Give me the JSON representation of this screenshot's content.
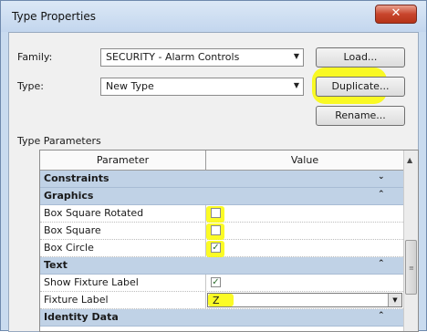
{
  "dialog": {
    "title": "Type Properties",
    "close_symbol": "✕"
  },
  "family": {
    "label": "Family:",
    "value": "SECURITY - Alarm Controls"
  },
  "type": {
    "label": "Type:",
    "value": "New Type"
  },
  "buttons": {
    "load": "Load...",
    "duplicate": "Duplicate...",
    "rename": "Rename..."
  },
  "section_label": "Type Parameters",
  "table": {
    "headers": [
      "Parameter",
      "Value"
    ],
    "rows": [
      {
        "kind": "group",
        "name": "Constraints",
        "chevron": "⌄"
      },
      {
        "kind": "group",
        "name": "Graphics",
        "chevron": "⌃"
      },
      {
        "kind": "param",
        "name": "Box Square Rotated",
        "checked": false
      },
      {
        "kind": "param",
        "name": "Box Square",
        "checked": false
      },
      {
        "kind": "param",
        "name": "Box Circle",
        "checked": true,
        "check_symbol": "✓"
      },
      {
        "kind": "group",
        "name": "Text",
        "chevron": "⌃"
      },
      {
        "kind": "param",
        "name": "Show Fixture Label",
        "checked": true,
        "check_symbol": "✓"
      },
      {
        "kind": "param",
        "name": "Fixture Label",
        "value": "Z"
      },
      {
        "kind": "group",
        "name": "Identity Data",
        "chevron": "⌃"
      }
    ]
  },
  "scrollbar": {
    "up_symbol": "▲",
    "grip_symbol": "≡"
  },
  "colors": {
    "highlight": "#faff00",
    "group_row": "#c0d2e6",
    "window_frame": "#c9dbef"
  }
}
